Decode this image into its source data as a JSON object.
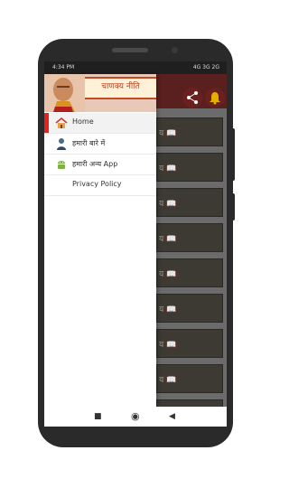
{
  "status_bar": {
    "time": "4:34 PM",
    "indicators": "4G 3G 2G"
  },
  "app": {
    "title": "चाणक्य नीति",
    "list_item_text": "य 📖"
  },
  "drawer": {
    "items": [
      {
        "label": "Home",
        "icon": "home-icon",
        "active": true
      },
      {
        "label": "हमारी बारे में",
        "icon": "person-icon",
        "active": false
      },
      {
        "label": "हमारी अन्य App",
        "icon": "android-icon",
        "active": false
      },
      {
        "label": "Privacy Policy",
        "icon": "",
        "active": false
      }
    ]
  },
  "colors": {
    "accent": "#e52323",
    "appbar": "#5a1f1f",
    "list_item_bg": "#3d3a33"
  }
}
